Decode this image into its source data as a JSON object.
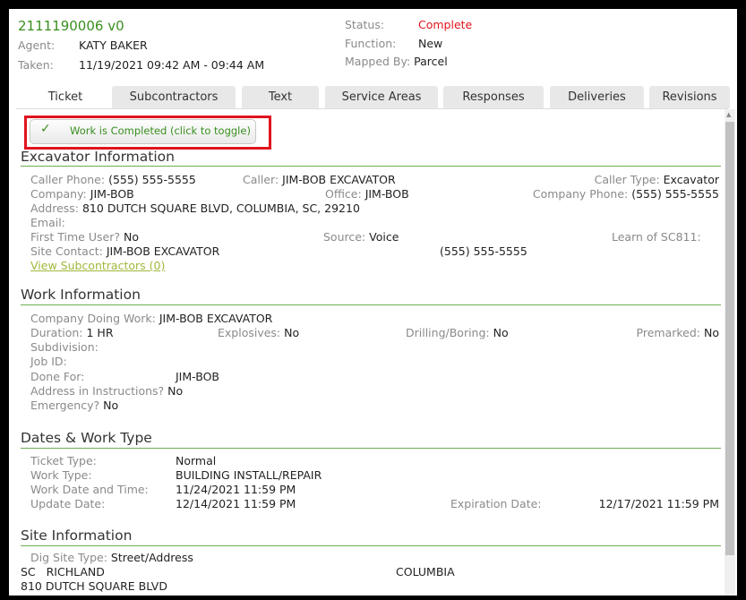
{
  "ticket": {
    "number": "2111190006 v0",
    "agent_label": "Agent:",
    "agent": "KATY BAKER",
    "taken_label": "Taken:",
    "taken": "11/19/2021 09:42 AM - 09:44 AM",
    "status_label": "Status:",
    "status": "Complete",
    "function_label": "Function:",
    "function": "New",
    "mapped_label": "Mapped By:",
    "mapped": "Parcel"
  },
  "tabs": [
    "Ticket",
    "Subcontractors",
    "Text",
    "Service Areas",
    "Responses",
    "Deliveries",
    "Revisions"
  ],
  "toggle": {
    "label": "Work is Completed (click to toggle)",
    "icon": "check-icon"
  },
  "excavator": {
    "title": "Excavator Information",
    "caller_phone_label": "Caller Phone:",
    "caller_phone": "(555) 555-5555",
    "caller_label": "Caller:",
    "caller": "JIM-BOB EXCAVATOR",
    "caller_type_label": "Caller Type:",
    "caller_type": "Excavator",
    "company_label": "Company:",
    "company": "JIM-BOB",
    "office_label": "Office:",
    "office": "JIM-BOB",
    "company_phone_label": "Company Phone:",
    "company_phone": "(555) 555-5555",
    "address_label": "Address:",
    "address": "810 DUTCH SQUARE BLVD, COLUMBIA, SC, 29210",
    "email_label": "Email:",
    "first_time_label": "First Time User?",
    "first_time": "No",
    "source_label": "Source:",
    "source": "Voice",
    "learn_label": "Learn of SC811:",
    "site_contact_label": "Site Contact:",
    "site_contact": "JIM-BOB EXCAVATOR",
    "site_contact_phone": "(555) 555-5555",
    "subcontractors_link": "View Subcontractors (0)"
  },
  "work": {
    "title": "Work Information",
    "company_doing_label": "Company Doing Work:",
    "company_doing": "JIM-BOB EXCAVATOR",
    "duration_label": "Duration:",
    "duration": "1 HR",
    "explosives_label": "Explosives:",
    "explosives": "No",
    "drilling_label": "Drilling/Boring:",
    "drilling": "No",
    "premarked_label": "Premarked:",
    "premarked": "No",
    "subdivision_label": "Subdivision:",
    "job_id_label": "Job ID:",
    "done_for_label": "Done For:",
    "done_for": "JIM-BOB",
    "address_instr_label": "Address in Instructions?",
    "address_instr": "No",
    "emergency_label": "Emergency?",
    "emergency": "No"
  },
  "dates": {
    "title": "Dates & Work Type",
    "ticket_type_label": "Ticket Type:",
    "ticket_type": "Normal",
    "work_type_label": "Work Type:",
    "work_type": "BUILDING INSTALL/REPAIR",
    "work_date_label": "Work Date and Time:",
    "work_date": "11/24/2021 11:59 PM",
    "update_label": "Update Date:",
    "update": "12/14/2021 11:59 PM",
    "expiration_label": "Expiration Date:",
    "expiration": "12/17/2021 11:59 PM"
  },
  "site": {
    "title": "Site Information",
    "dig_site_label": "Dig Site Type:",
    "dig_site": "Street/Address",
    "state": "SC",
    "county": "RICHLAND",
    "city": "COLUMBIA",
    "street": "810 DUTCH SQUARE BLVD"
  },
  "colors": {
    "accent": "#3a8f1f",
    "status": "#e0141e",
    "section_line": "#6aae55"
  }
}
